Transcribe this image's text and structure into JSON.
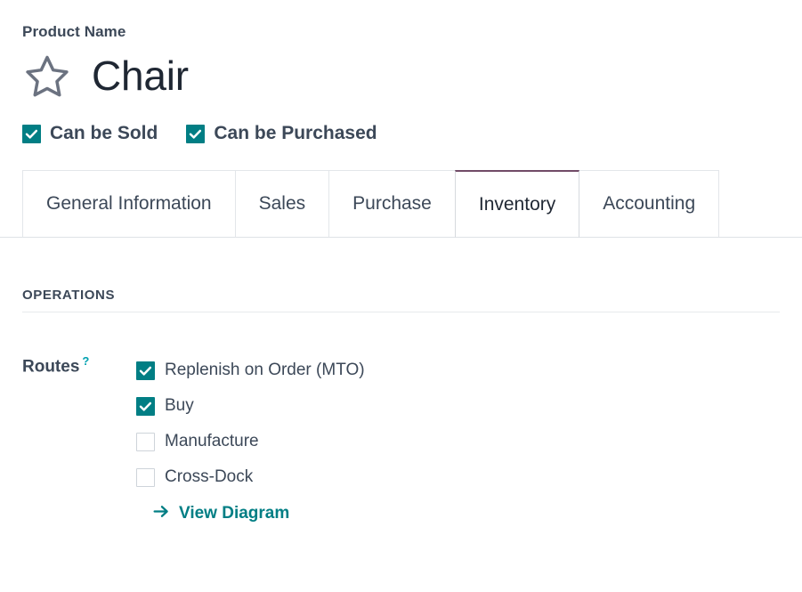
{
  "header": {
    "field_label": "Product Name",
    "product_name": "Chair",
    "favorite_icon": "star-outline-icon",
    "favorited": false
  },
  "flags": [
    {
      "label": "Can be Sold",
      "checked": true
    },
    {
      "label": "Can be Purchased",
      "checked": true
    }
  ],
  "tabs": [
    {
      "label": "General Information",
      "active": false
    },
    {
      "label": "Sales",
      "active": false
    },
    {
      "label": "Purchase",
      "active": false
    },
    {
      "label": "Inventory",
      "active": true
    },
    {
      "label": "Accounting",
      "active": false
    }
  ],
  "inventory": {
    "group_title": "OPERATIONS",
    "routes": {
      "label": "Routes",
      "help_marker": "?",
      "options": [
        {
          "label": "Replenish on Order (MTO)",
          "checked": true
        },
        {
          "label": "Buy",
          "checked": true
        },
        {
          "label": "Manufacture",
          "checked": false
        },
        {
          "label": "Cross-Dock",
          "checked": false
        }
      ],
      "view_diagram_label": "View Diagram",
      "view_diagram_icon": "arrow-right-icon"
    }
  },
  "colors": {
    "accent_teal": "#017e84",
    "active_tab_top": "#714b67",
    "text": "#3c4858",
    "border": "#dee2e6",
    "help": "#00a1b0"
  }
}
